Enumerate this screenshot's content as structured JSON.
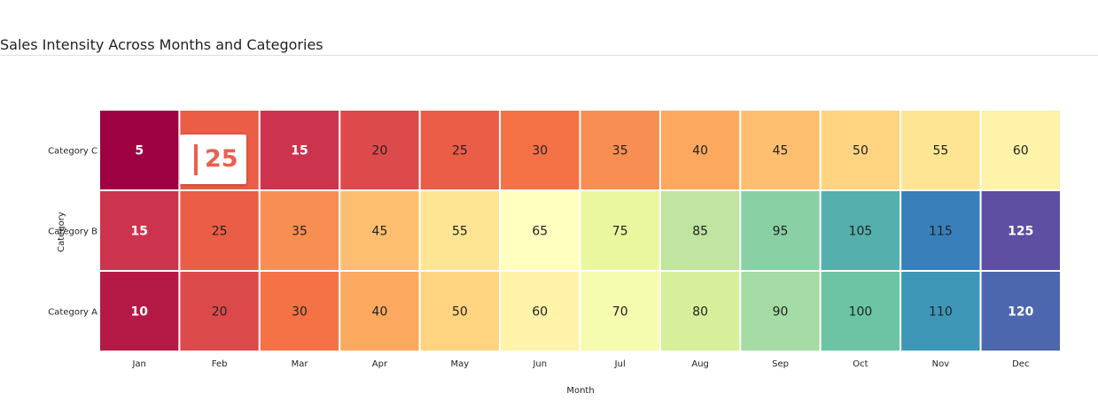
{
  "header": {
    "title": "Sales Intensity Across Months and Categories"
  },
  "tooltip": {
    "value": "25",
    "color": "#e8604f"
  },
  "chart_data": {
    "type": "heatmap",
    "title": "Sales Intensity Across Months and Categories",
    "xlabel": "Month",
    "ylabel": "Category",
    "x": [
      "Jan",
      "Feb",
      "Mar",
      "Apr",
      "May",
      "Jun",
      "Jul",
      "Aug",
      "Sep",
      "Oct",
      "Nov",
      "Dec"
    ],
    "y": [
      "Category C",
      "Category B",
      "Category A"
    ],
    "values": [
      [
        5,
        25,
        15,
        20,
        25,
        30,
        35,
        40,
        45,
        50,
        55,
        60
      ],
      [
        15,
        25,
        35,
        45,
        55,
        65,
        75,
        85,
        95,
        105,
        115,
        125
      ],
      [
        10,
        20,
        30,
        40,
        50,
        60,
        70,
        80,
        90,
        100,
        110,
        120
      ]
    ],
    "color_scale": "Spectral",
    "range": [
      5,
      125
    ]
  }
}
